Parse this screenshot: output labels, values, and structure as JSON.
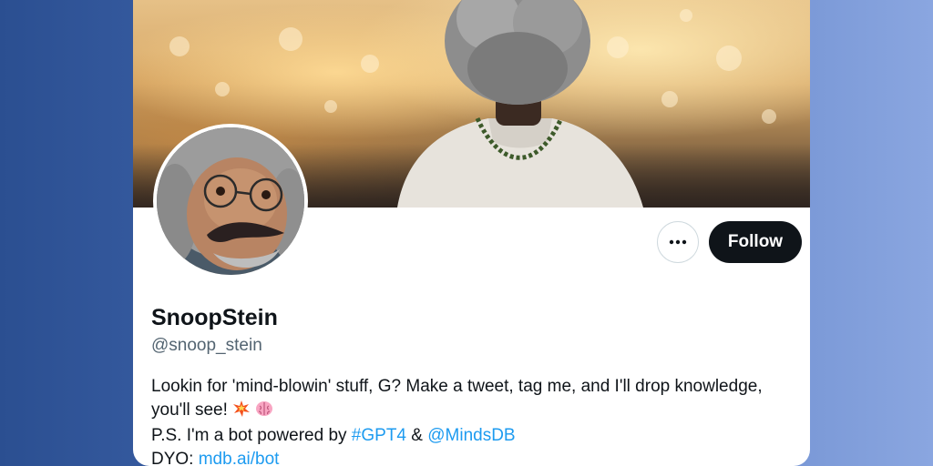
{
  "profile": {
    "display_name": "SnoopStein",
    "handle": "@snoop_stein",
    "bio": {
      "line1": "Lookin for 'mind-blowin' stuff, G? Make a tweet, tag me, and I'll drop knowledge,",
      "line2": "you'll see!",
      "line3_prefix": "P.S. I'm a bot powered by ",
      "hashtag": "#GPT4",
      "ampersand": " & ",
      "mention": "@MindsDB",
      "line4_prefix": "DYO: ",
      "url": "mdb.ai/bot"
    }
  },
  "actions": {
    "more_icon": "ellipsis-icon",
    "follow_label": "Follow"
  },
  "colors": {
    "link": "#1d9bf0",
    "follow_bg": "#0f1419",
    "handle": "#536471"
  }
}
